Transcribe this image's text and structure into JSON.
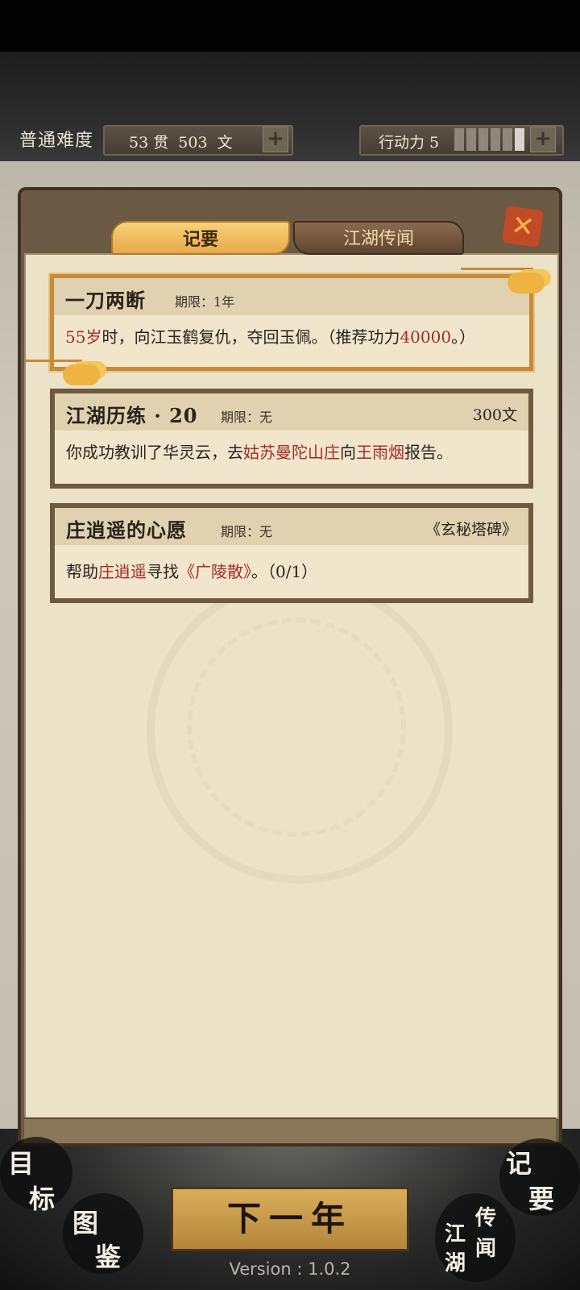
{
  "status_bar": {
    "difficulty": "普通难度",
    "money_text": "53 贯  503  文",
    "action_power_label": "行动力 5",
    "action_power_value": 5
  },
  "tabs": {
    "active": "记要",
    "inactive": "江湖传闻"
  },
  "quests": [
    {
      "title": "一刀两断",
      "period": "期限：1年",
      "reward": "",
      "desc_parts": [
        {
          "text": "55岁",
          "red": true
        },
        {
          "text": "时，向江玉鹤复仇，夺回玉佩。（推荐功力",
          "red": false
        },
        {
          "text": "40000",
          "red": true
        },
        {
          "text": "。）",
          "red": false
        }
      ]
    },
    {
      "title": "江湖历练 · 20",
      "period": "期限：无",
      "reward": "300文",
      "desc_parts": [
        {
          "text": "你成功教训了华灵云，去",
          "red": false
        },
        {
          "text": "姑苏曼陀山庄",
          "red": true
        },
        {
          "text": "向",
          "red": false
        },
        {
          "text": "王雨烟",
          "red": true
        },
        {
          "text": "报告。",
          "red": false
        }
      ]
    },
    {
      "title": "庄逍遥的心愿",
      "period": "期限：无",
      "reward": "《玄秘塔碑》",
      "desc_parts": [
        {
          "text": "帮助",
          "red": false
        },
        {
          "text": "庄逍遥",
          "red": true
        },
        {
          "text": "寻找",
          "red": false
        },
        {
          "text": "《广陵散》",
          "red": true
        },
        {
          "text": "。（0/1）",
          "red": false
        }
      ]
    }
  ],
  "bottom_nav": {
    "goal": [
      "目",
      "标"
    ],
    "atlas": [
      "图",
      "鉴"
    ],
    "rumors": [
      "江",
      "湖",
      "传",
      "闻"
    ],
    "notes": [
      "记",
      "要"
    ],
    "next_year": "下一年",
    "version": "Version : 1.0.2"
  },
  "colors": {
    "accent_red": "#a32a2a",
    "tab_gold": "#f7d27a",
    "panel_brown": "#6b5a44"
  }
}
